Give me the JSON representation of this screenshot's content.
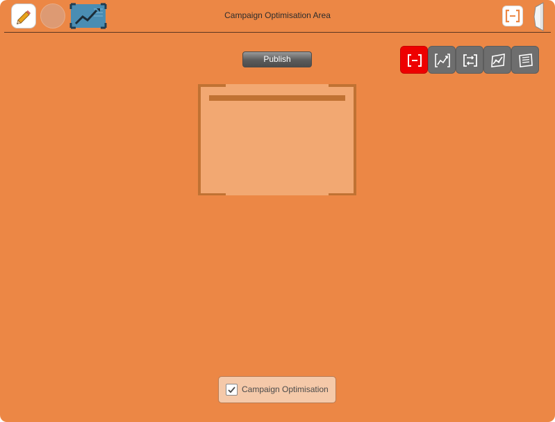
{
  "header": {
    "title": "Campaign Optimisation Area",
    "left_buttons": [
      {
        "icon": "pencil-icon"
      },
      {
        "icon": "circle-icon"
      },
      {
        "icon": "trend-chart-icon"
      }
    ],
    "right_buttons": [
      {
        "icon": "frame-bracket-icon"
      },
      {
        "icon": "side-panel-tab-icon"
      }
    ]
  },
  "main": {
    "publish_label": "Publish",
    "toolbar": [
      {
        "icon": "frame-bracket-icon",
        "active": true
      },
      {
        "icon": "line-chart-icon",
        "active": false
      },
      {
        "icon": "cycle-arrows-icon",
        "active": false
      },
      {
        "icon": "graph-card-icon",
        "active": false
      },
      {
        "icon": "list-sheet-icon",
        "active": false
      }
    ]
  },
  "footer": {
    "checkbox_label": "Campaign Optimisation",
    "checked": true
  },
  "colors": {
    "background": "#ec8745",
    "panel": "#f2a872",
    "panel_accent": "#c07233",
    "active_tool": "#ee0000",
    "inactive_tool": "#6e6e6e"
  }
}
